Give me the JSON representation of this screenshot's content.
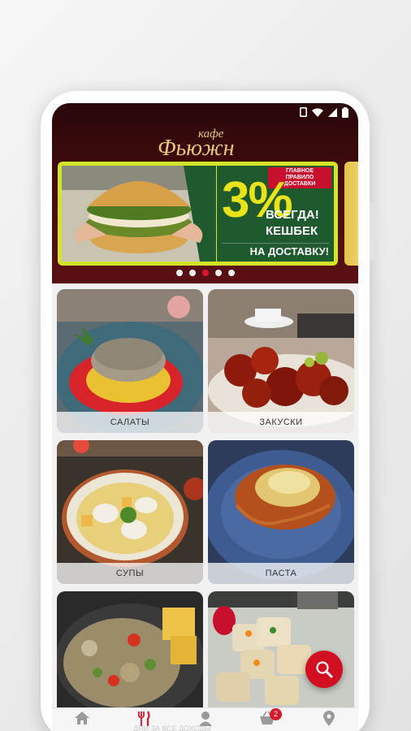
{
  "logo": {
    "small": "кафе",
    "big": "Фьюжн"
  },
  "banner": {
    "rules": "ГЛАВНОЕ ПРАВИЛО ДОСТАВКИ",
    "percent": "3%",
    "line1": "ВСЕГДА!",
    "line2": "КЕШБЕК",
    "line3": "НА ДОСТАВКУ!"
  },
  "carousel": {
    "count": 5,
    "active": 2
  },
  "categories": [
    {
      "label": "САЛАТЫ"
    },
    {
      "label": "ЗАКУСКИ"
    },
    {
      "label": "СУПЫ"
    },
    {
      "label": "ПАСТА"
    },
    {
      "label": ""
    },
    {
      "label": ""
    }
  ],
  "nav": {
    "cart_badge": "2",
    "ghost": "ДНИ ЗА ВСЕ ДОХОДЫ",
    "icons": [
      "home-icon",
      "fork-knife-icon",
      "user-icon",
      "cart-icon",
      "location-pin-icon"
    ],
    "active_color": "#d7182a",
    "inactive_color": "#9a9a9a"
  },
  "colors": {
    "header": "#4a0d0f",
    "accent": "#d7182a",
    "gold": "#e7c77c"
  }
}
